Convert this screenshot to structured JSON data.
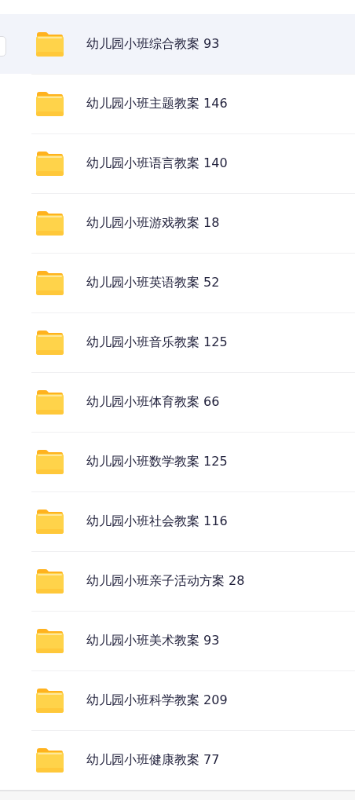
{
  "folders": [
    {
      "name": "幼儿园小班综合教案 93",
      "selected": true
    },
    {
      "name": "幼儿园小班主题教案 146",
      "selected": false
    },
    {
      "name": "幼儿园小班语言教案 140",
      "selected": false
    },
    {
      "name": "幼儿园小班游戏教案 18",
      "selected": false
    },
    {
      "name": "幼儿园小班英语教案 52",
      "selected": false
    },
    {
      "name": "幼儿园小班音乐教案 125",
      "selected": false
    },
    {
      "name": "幼儿园小班体育教案 66",
      "selected": false
    },
    {
      "name": "幼儿园小班数学教案 125",
      "selected": false
    },
    {
      "name": "幼儿园小班社会教案 116",
      "selected": false
    },
    {
      "name": "幼儿园小班亲子活动方案 28",
      "selected": false
    },
    {
      "name": "幼儿园小班美术教案 93",
      "selected": false
    },
    {
      "name": "幼儿园小班科学教案 209",
      "selected": false
    },
    {
      "name": "幼儿园小班健康教案 77",
      "selected": false
    }
  ]
}
